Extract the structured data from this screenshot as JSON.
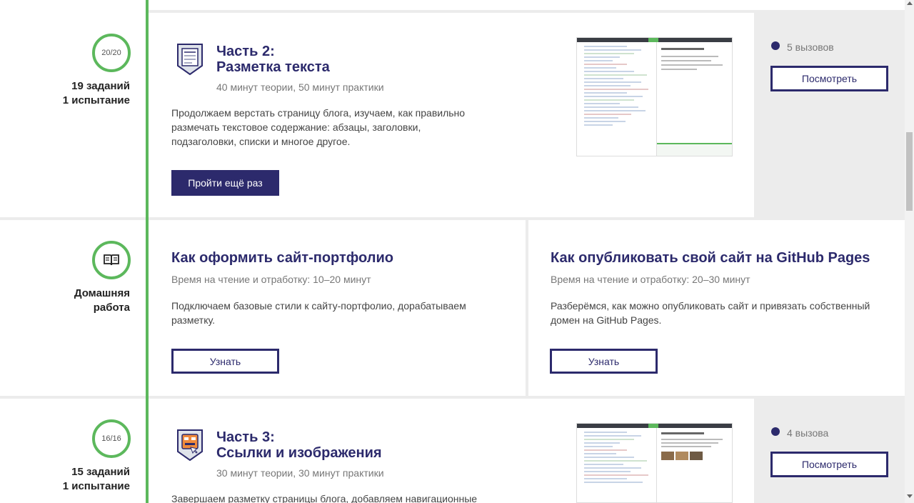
{
  "lessons": [
    {
      "progress": "20/20",
      "tasks": "19 заданий",
      "tests": "1 испытание",
      "title_line1": "Часть 2:",
      "title_line2": "Разметка текста",
      "meta": "40 минут теории, 50 минут практики",
      "description": "Продолжаем верстать страницу блога, изучаем, как правильно размечать текстовое содержание: абзацы, заголовки, подзаголовки, списки и многое другое.",
      "button": "Пройти ещё раз",
      "calls": "5 вызовов",
      "side_button": "Посмотреть",
      "icon": "document-badge-icon"
    },
    {
      "progress": "16/16",
      "tasks": "15 заданий",
      "tests": "1 испытание",
      "title_line1": "Часть 3:",
      "title_line2": "Ссылки и изображения",
      "meta": "30 минут теории, 30 минут практики",
      "description": "Завершаем разметку страницы блога, добавляем навигационные",
      "calls": "4 вызова",
      "side_button": "Посмотреть",
      "icon": "image-badge-icon"
    }
  ],
  "homework": {
    "label_line1": "Домашняя",
    "label_line2": "работа",
    "icon": "book-icon",
    "items": [
      {
        "title": "Как оформить сайт-портфолио",
        "meta": "Время на чтение и отработку: 10–20 минут",
        "description": "Подключаем базовые стили к сайту-портфолио, дорабатываем разметку.",
        "button": "Узнать"
      },
      {
        "title": "Как опубликовать свой сайт на GitHub Pages",
        "meta": "Время на чтение и отработку: 20–30 минут",
        "description": "Разберёмся, как можно опубликовать сайт и привязать собственный домен на GitHub Pages.",
        "button": "Узнать"
      }
    ]
  },
  "colors": {
    "accent": "#2c2a6c",
    "timeline": "#5cb85c",
    "background": "#ececec"
  }
}
